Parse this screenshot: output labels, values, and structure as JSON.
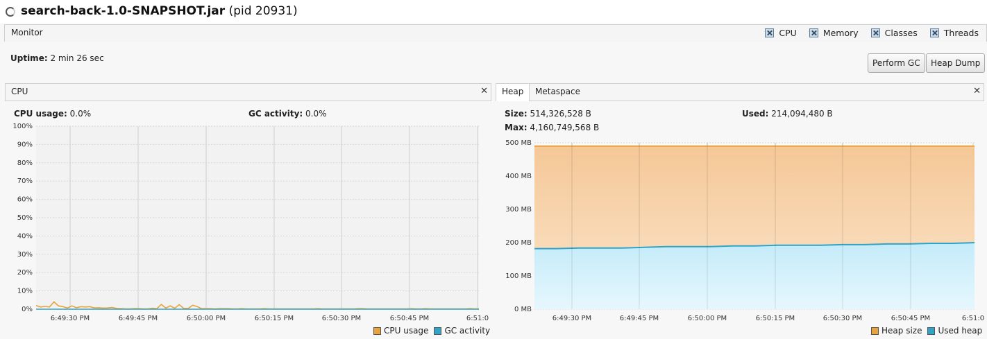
{
  "window": {
    "app_name": "search-back-1.0-SNAPSHOT.jar",
    "pid": "(pid 20931)"
  },
  "tabs": {
    "monitor": "Monitor"
  },
  "toggles": [
    "CPU",
    "Memory",
    "Classes",
    "Threads"
  ],
  "uptime": {
    "label": "Uptime:",
    "value": "2 min 26 sec"
  },
  "buttons": {
    "perform_gc": "Perform GC",
    "heap_dump": "Heap Dump"
  },
  "cpu_panel": {
    "tab": "CPU",
    "cpu_usage_label": "CPU usage:",
    "cpu_usage_value": "0.0%",
    "gc_activity_label": "GC activity:",
    "gc_activity_value": "0.0%",
    "legend": [
      "CPU usage",
      "GC activity"
    ]
  },
  "memory_panel": {
    "tabs": [
      "Heap",
      "Metaspace"
    ],
    "size_label": "Size:",
    "size_value": "514,326,528 B",
    "used_label": "Used:",
    "used_value": "214,094,480 B",
    "max_label": "Max:",
    "max_value": "4,160,749,568 B",
    "legend": [
      "Heap size",
      "Used heap"
    ]
  },
  "colors": {
    "cpu": "#e8a33d",
    "gc": "#2fa4c8",
    "heap_fill": "#f6c891",
    "used_fill": "#cdeefa"
  },
  "chart_data": [
    {
      "type": "line",
      "title": "CPU",
      "x_ticks": [
        "6:49:30 PM",
        "6:49:45 PM",
        "6:50:00 PM",
        "6:50:15 PM",
        "6:50:30 PM",
        "6:50:45 PM",
        "6:51:0"
      ],
      "y_ticks": [
        "0%",
        "10%",
        "20%",
        "30%",
        "40%",
        "50%",
        "60%",
        "70%",
        "80%",
        "90%",
        "100%"
      ],
      "ylim": [
        0,
        100
      ],
      "series": [
        {
          "name": "CPU usage",
          "values": [
            2,
            1.2,
            1.5,
            1.2,
            4,
            1.8,
            1.4,
            0.6,
            1.8,
            0.8,
            1.4,
            1.2,
            1.4,
            0.7,
            0.8,
            0.6,
            0.7,
            0.9,
            0.4,
            0.3,
            0.2,
            0.2,
            0.3,
            0.3,
            0.2,
            0.2,
            0.5,
            0.3,
            2.6,
            0.6,
            1.8,
            0.5,
            2.5,
            0.4,
            0.4,
            2.2,
            1.4,
            0.3,
            0.3,
            0.3,
            0.2,
            0.3,
            0.3,
            0.3,
            0.2,
            0.2,
            0.3,
            0.2,
            0.2,
            0.2,
            0.2,
            0.3,
            0.2,
            0.2,
            0.2,
            0.2,
            0.2,
            0.2,
            0.2,
            0.2,
            0.2,
            0.2,
            0.2,
            0.3,
            0.2,
            0.2,
            0.2,
            0.2,
            0.2,
            0.2,
            0.2,
            0.2,
            0.3,
            0.3,
            0.2,
            0.2,
            0.2,
            0.2,
            0.2,
            0.2,
            0.2,
            0.2,
            0.2,
            0.2,
            0.3,
            0.2,
            0.2,
            0.3,
            0.2,
            0.2,
            0.2,
            0.2,
            0.2,
            0.2,
            0.2,
            0.2,
            0.2,
            0.3,
            0.2,
            0.2
          ]
        },
        {
          "name": "GC activity",
          "values": [
            0,
            0,
            0,
            0,
            0,
            0,
            0,
            0,
            0,
            0,
            0,
            0,
            0,
            0,
            0,
            0,
            0,
            0,
            0,
            0,
            0,
            0,
            0,
            0,
            0,
            0,
            0,
            0,
            0,
            0,
            0,
            0,
            0,
            0,
            0,
            0,
            0,
            0,
            0,
            0,
            0,
            0,
            0,
            0,
            0,
            0,
            0,
            0,
            0,
            0,
            0,
            0,
            0,
            0,
            0,
            0,
            0,
            0,
            0,
            0,
            0,
            0,
            0,
            0,
            0,
            0,
            0,
            0,
            0,
            0,
            0,
            0,
            0,
            0,
            0,
            0,
            0,
            0,
            0,
            0,
            0,
            0,
            0,
            0,
            0,
            0,
            0,
            0,
            0,
            0,
            0,
            0,
            0,
            0,
            0,
            0,
            0,
            0,
            0,
            0
          ]
        }
      ]
    },
    {
      "type": "area",
      "title": "Heap",
      "x_ticks": [
        "6:49:30 PM",
        "6:49:45 PM",
        "6:50:00 PM",
        "6:50:15 PM",
        "6:50:30 PM",
        "6:50:45 PM",
        "6:51:0"
      ],
      "y_ticks": [
        "0 MB",
        "100 MB",
        "200 MB",
        "300 MB",
        "400 MB",
        "500 MB"
      ],
      "ylim": [
        0,
        500
      ],
      "series": [
        {
          "name": "Heap size",
          "values": [
            490,
            490,
            490,
            490,
            490,
            490,
            490,
            490,
            490,
            490,
            490,
            490,
            490,
            490,
            490,
            490,
            490,
            490,
            490,
            490,
            490
          ]
        },
        {
          "name": "Used heap",
          "values": [
            182,
            182,
            184,
            184,
            184,
            186,
            188,
            188,
            188,
            190,
            190,
            192,
            192,
            192,
            194,
            194,
            196,
            196,
            198,
            198,
            200
          ]
        }
      ]
    }
  ]
}
